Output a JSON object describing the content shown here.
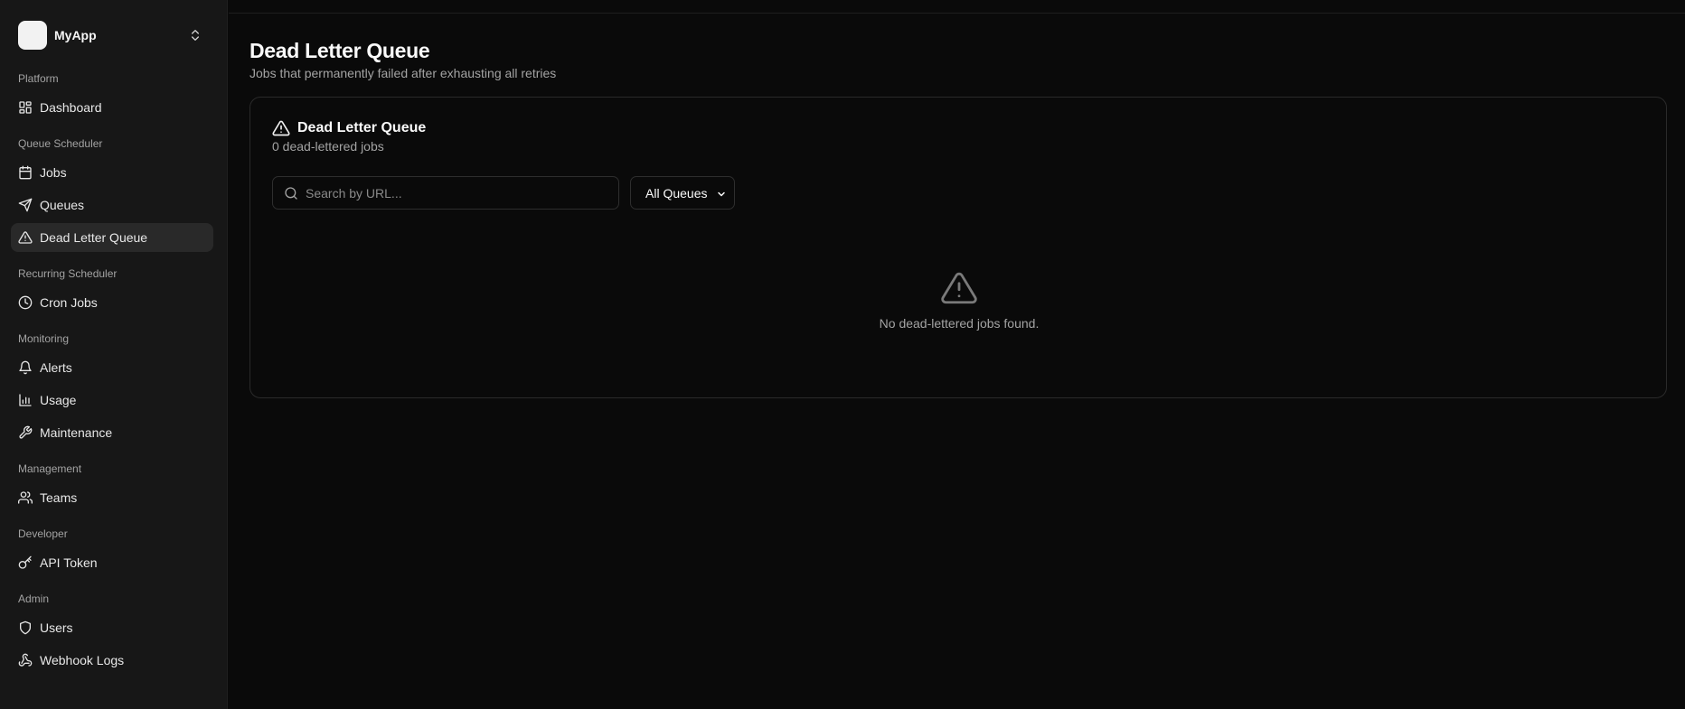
{
  "app": {
    "name": "MyApp"
  },
  "sidebar": {
    "groups": [
      {
        "label": "Platform",
        "items": [
          {
            "label": "Dashboard",
            "icon": "dashboard-grid-icon"
          }
        ]
      },
      {
        "label": "Queue Scheduler",
        "items": [
          {
            "label": "Jobs",
            "icon": "calendar-icon"
          },
          {
            "label": "Queues",
            "icon": "send-icon"
          },
          {
            "label": "Dead Letter Queue",
            "icon": "alert-triangle-icon",
            "active": true
          }
        ]
      },
      {
        "label": "Recurring Scheduler",
        "items": [
          {
            "label": "Cron Jobs",
            "icon": "clock-icon"
          }
        ]
      },
      {
        "label": "Monitoring",
        "items": [
          {
            "label": "Alerts",
            "icon": "bell-icon"
          },
          {
            "label": "Usage",
            "icon": "bar-chart-icon"
          },
          {
            "label": "Maintenance",
            "icon": "wrench-icon"
          }
        ]
      },
      {
        "label": "Management",
        "items": [
          {
            "label": "Teams",
            "icon": "users-icon"
          }
        ]
      },
      {
        "label": "Developer",
        "items": [
          {
            "label": "API Token",
            "icon": "key-icon"
          }
        ]
      },
      {
        "label": "Admin",
        "items": [
          {
            "label": "Users",
            "icon": "shield-icon"
          },
          {
            "label": "Webhook Logs",
            "icon": "webhook-icon"
          }
        ]
      }
    ]
  },
  "page": {
    "title": "Dead Letter Queue",
    "subtitle": "Jobs that permanently failed after exhausting all retries"
  },
  "card": {
    "title": "Dead Letter Queue",
    "description": "0 dead-lettered jobs",
    "search": {
      "placeholder": "Search by URL...",
      "value": ""
    },
    "queue_filter": {
      "selected": "All Queues"
    },
    "empty_message": "No dead-lettered jobs found."
  },
  "colors": {
    "background": "#0a0a0a",
    "sidebar": "#171717",
    "active_item": "#292929",
    "muted_text": "#a3a3a3",
    "border": "#2a2a2a"
  }
}
